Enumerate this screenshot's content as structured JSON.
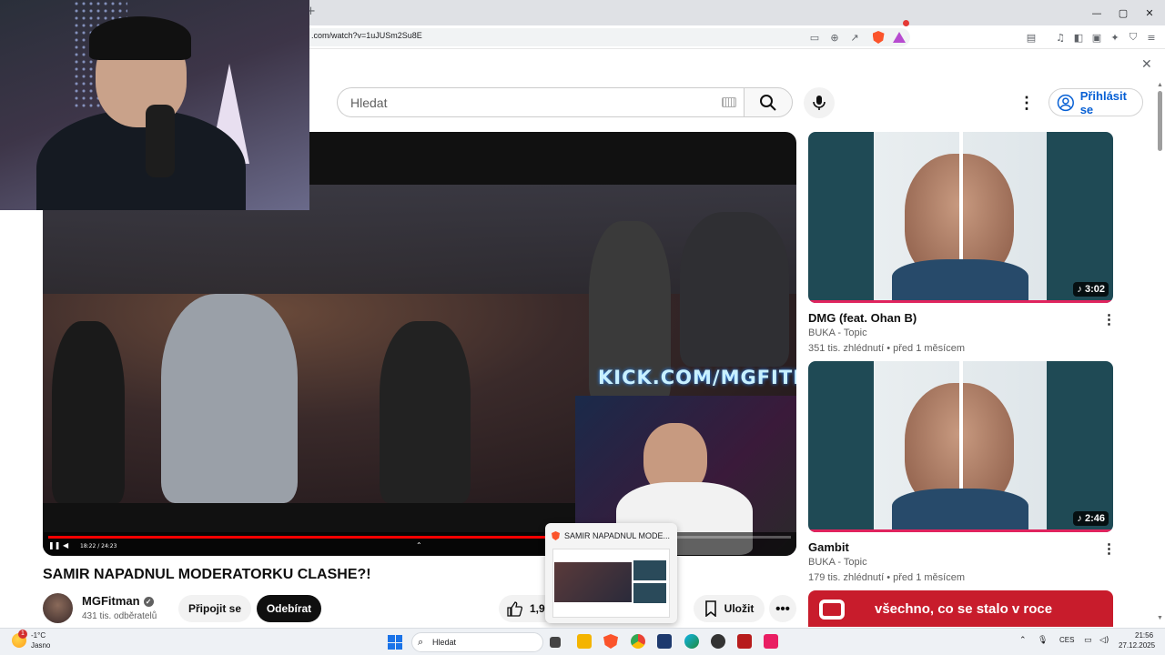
{
  "browser": {
    "url": ".com/watch?v=1uJUSm2Su8E",
    "window_controls": [
      "—",
      "▢",
      "✕"
    ]
  },
  "youtube": {
    "search_placeholder": "Hledat",
    "signin_label": "Přihlásit se",
    "close_glyph": "✕"
  },
  "player": {
    "overlay_text": "KICK.COM/MGFITMAN",
    "time_display": "18:22 / 24:23",
    "progress_fraction": 0.75
  },
  "video": {
    "title": "SAMIR NAPADNUL MODERATORKU CLASHE?!",
    "channel": "MGFitman",
    "subscribers": "431 tis. odběratelů",
    "join_label": "Připojit se",
    "subscribe_label": "Odebírat",
    "likes": "1,9",
    "save_label": "Uložit"
  },
  "hover_preview": {
    "title": "SAMIR NAPADNUL MODE..."
  },
  "recommendations": [
    {
      "title": "DMG (feat. Ohan B)",
      "channel": "BUKA - Topic",
      "meta": "351 tis. zhlédnutí • před 1 měsícem",
      "duration": "♪ 3:02"
    },
    {
      "title": "Gambit",
      "channel": "BUKA - Topic",
      "meta": "179 tis. zhlédnutí • před 1 měsícem",
      "duration": "♪ 2:46"
    },
    {
      "banner_text": "všechno, co se stalo v roce"
    }
  ],
  "taskbar": {
    "weather_temp": "-1°C",
    "weather_condition": "Jasno",
    "weather_badge": "1",
    "search_placeholder": "Hledat",
    "language": "CES",
    "time": "21:56",
    "date": "27.12.2025"
  }
}
